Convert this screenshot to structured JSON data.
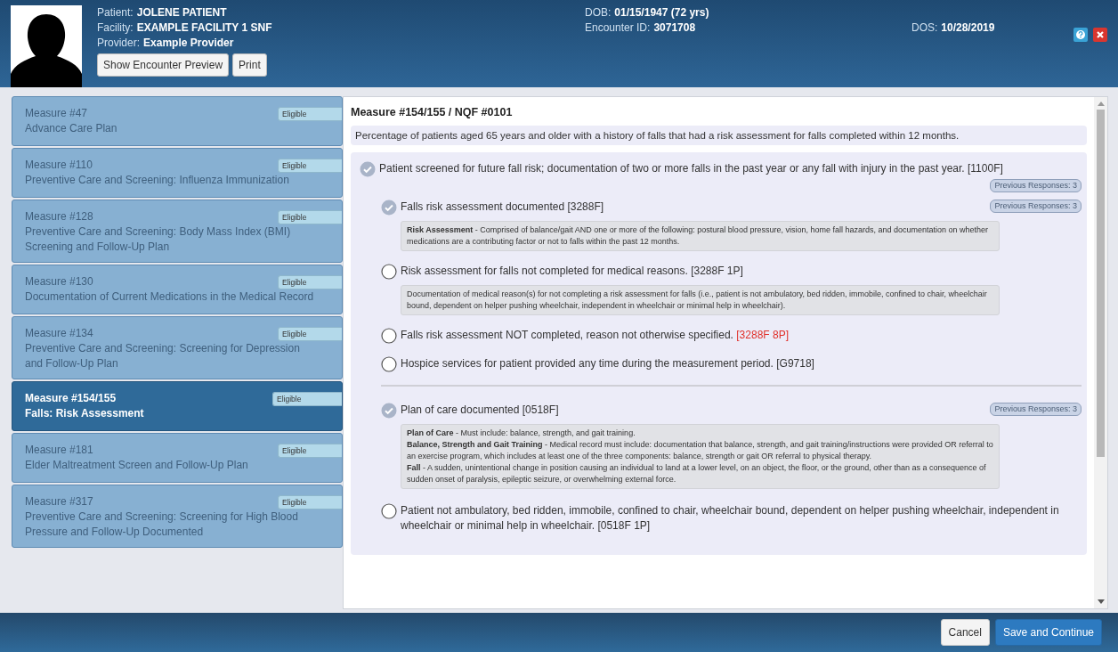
{
  "header": {
    "columns": [
      {
        "fields": [
          {
            "label": "Patient:",
            "value": "JOLENE PATIENT"
          },
          {
            "label": "Facility:",
            "value": "EXAMPLE FACILITY 1 SNF"
          },
          {
            "label": "Provider:",
            "value": "Example Provider"
          }
        ]
      },
      {
        "fields": [
          {
            "label": "DOB:",
            "value": "01/15/1947 (72 yrs)"
          },
          {
            "label": "Encounter ID:",
            "value": "3071708"
          }
        ]
      },
      {
        "fields": [
          {
            "label": "DOS:",
            "value": "10/28/2019"
          }
        ]
      }
    ],
    "buttons": [
      "Show Encounter Preview",
      "Print"
    ]
  },
  "measures": [
    {
      "number": "Measure #47",
      "title": "Advance Care Plan",
      "badge": "Eligible",
      "selected": false
    },
    {
      "number": "Measure #110",
      "title": "Preventive Care and Screening: Influenza Immunization",
      "badge": "Eligible",
      "selected": false
    },
    {
      "number": "Measure #128",
      "title": "Preventive Care and Screening: Body Mass Index (BMI) Screening and Follow-Up Plan",
      "badge": "Eligible",
      "selected": false
    },
    {
      "number": "Measure #130",
      "title": "Documentation of Current Medications in the Medical Record",
      "badge": "Eligible",
      "selected": false
    },
    {
      "number": "Measure #134",
      "title": "Preventive Care and Screening: Screening for Depression and Follow-Up Plan",
      "badge": "Eligible",
      "selected": false
    },
    {
      "number": "Measure #154/155",
      "title": "Falls: Risk Assessment",
      "badge": "Eligible",
      "selected": true
    },
    {
      "number": "Measure #181",
      "title": "Elder Maltreatment Screen and Follow-Up Plan",
      "badge": "Eligible",
      "selected": false
    },
    {
      "number": "Measure #317",
      "title": "Preventive Care and Screening: Screening for High Blood Pressure and Follow-Up Documented",
      "badge": "Eligible",
      "selected": false
    }
  ],
  "detail": {
    "title": "Measure #154/155 / NQF #0101",
    "description": "Percentage of patients aged 65 years and older with a history of falls that had a risk assessment for falls completed within 12 months.",
    "sections": [
      {
        "options": [
          {
            "text": "Patient screened for future fall risk; documentation of two or more falls in the past year or any fall with injury in the past year.",
            "code": "[1100F]",
            "code_flagged": false,
            "checked": true,
            "previous_responses": "Previous Responses: 3",
            "children": [
              {
                "text": "Falls risk assessment documented",
                "code": "[3288F]",
                "code_flagged": false,
                "checked": true,
                "previous_responses": "Previous Responses: 3",
                "notes": [
                  "**Risk Assessment** - Comprised of balance/gait AND one or more of the following: postural blood pressure, vision, home fall hazards, and documentation on whether medications are a contributing factor or not to falls within the past 12 months."
                ]
              },
              {
                "text": "Risk assessment for falls not completed for medical reasons.",
                "code": "[3288F 1P]",
                "code_flagged": false,
                "checked": false,
                "notes": [
                  "Documentation of medical reason(s) for not completing a risk assessment for falls (i.e., patient is not ambulatory, bed ridden, immobile, confined to chair, wheelchair bound, dependent on helper pushing wheelchair, independent in wheelchair or minimal help in wheelchair)."
                ]
              },
              {
                "text": "Falls risk assessment NOT completed, reason not otherwise specified.",
                "code": "[3288F 8P]",
                "code_flagged": true,
                "checked": false
              },
              {
                "text": "Hospice services for patient provided any time during the measurement period.",
                "code": "[G9718]",
                "code_flagged": false,
                "checked": false
              }
            ]
          }
        ]
      },
      {
        "options": [
          {
            "text": "Plan of care documented",
            "code": "[0518F]",
            "code_flagged": false,
            "checked": true,
            "previous_responses": "Previous Responses: 3",
            "notes": [
              "**Plan of Care** - Must include: balance, strength, and gait training.",
              "**Balance, Strength and Gait Training** - Medical record must include: documentation that balance, strength, and gait training/instructions were provided OR referral to an exercise program, which includes at least one of the three components: balance, strength or gait OR referral to physical therapy.",
              "**Fall** - A sudden, unintentional change in position causing an individual to land at a lower level, on an object, the floor, or the ground, other than as a consequence of sudden onset of paralysis, epileptic seizure, or overwhelming external force."
            ]
          },
          {
            "text": "Patient not ambulatory, bed ridden, immobile, confined to chair, wheelchair bound, dependent on helper pushing wheelchair, independent in wheelchair or minimal help in wheelchair.",
            "code": "[0518F 1P]",
            "code_flagged": false,
            "checked": false
          }
        ]
      }
    ]
  },
  "footer": {
    "buttons": [
      {
        "label": "Cancel",
        "kind": "secondary"
      },
      {
        "label": "Save and Continue",
        "kind": "primary"
      }
    ]
  }
}
